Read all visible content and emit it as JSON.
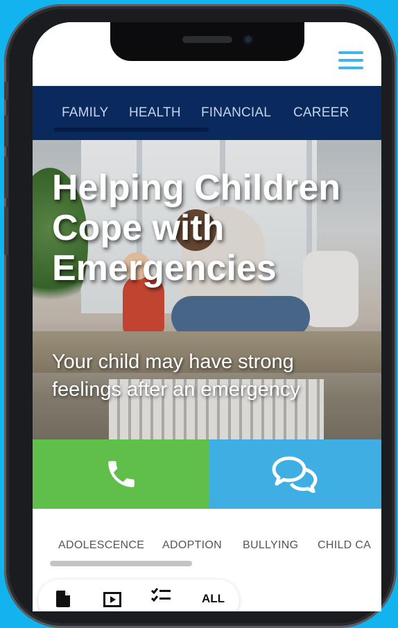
{
  "nav": {
    "tabs": [
      "FAMILY",
      "HEALTH",
      "FINANCIAL",
      "CAREER"
    ]
  },
  "hero": {
    "title": "Helping Children Cope with Emergencies",
    "subtitle": "Your child may have strong feelings after an emergency"
  },
  "actions": {
    "call_icon": "phone-icon",
    "chat_icon": "chat-bubbles-icon",
    "call_color": "#5fbf4a",
    "chat_color": "#3eaee3"
  },
  "topics": {
    "items": [
      "ADOLESCENCE",
      "ADOPTION",
      "BULLYING",
      "CHILD CA"
    ]
  },
  "filters": {
    "icons": [
      "document-icon",
      "video-icon",
      "checklist-icon"
    ],
    "all_label": "ALL"
  },
  "colors": {
    "background": "#12b4ef",
    "nav": "#0a2a5e",
    "accent": "#3fb6e6"
  }
}
